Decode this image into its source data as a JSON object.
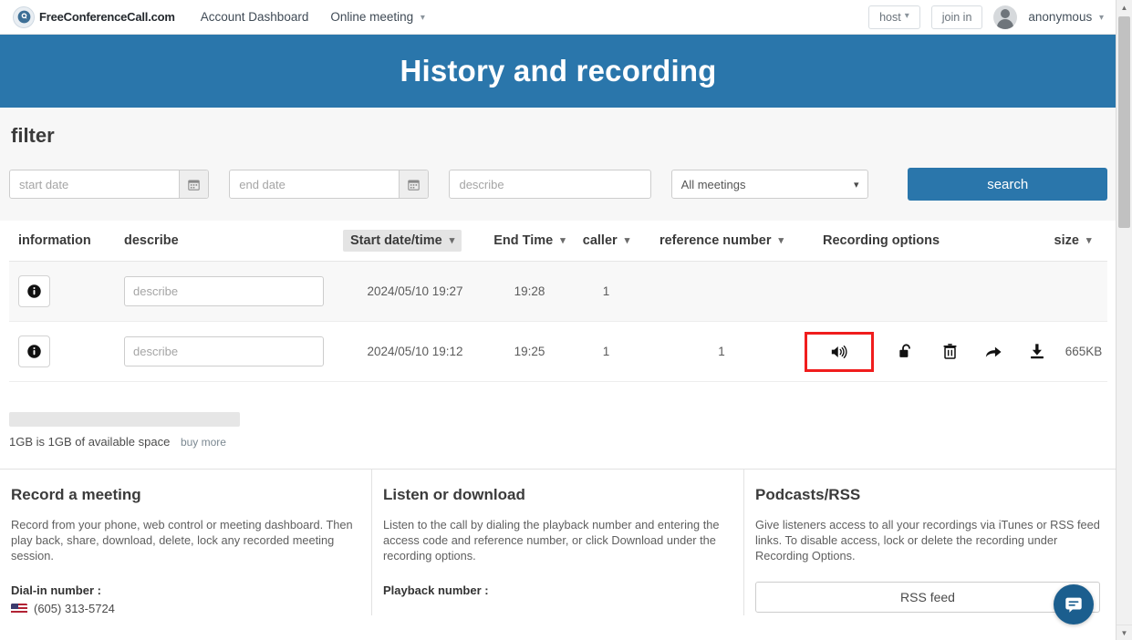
{
  "topnav": {
    "brand_name": "FreeConferenceCall.com",
    "brand_logo_icon": "phone-circle-icon",
    "links": [
      {
        "label": "Account Dashboard",
        "has_caret": false
      },
      {
        "label": "Online meeting",
        "has_caret": true
      }
    ],
    "host_button": "host",
    "join_button": "join in",
    "username": "anonymous",
    "avatar_icon": "user-avatar-icon"
  },
  "hero": {
    "title": "History and recording",
    "background_color": "#2a76ab"
  },
  "filter": {
    "title": "filter",
    "start_date_placeholder": "start date",
    "start_date_value": "",
    "end_date_placeholder": "end date",
    "end_date_value": "",
    "describe_placeholder": "describe",
    "describe_value": "",
    "meeting_select_value": "All meetings",
    "meeting_select_options": [
      "All meetings"
    ],
    "search_button": "search",
    "calendar_icon": "calendar-icon"
  },
  "table": {
    "headers": [
      {
        "label": "information",
        "sortable": false,
        "sorted": false
      },
      {
        "label": "describe",
        "sortable": false,
        "sorted": false
      },
      {
        "label": "Start date/time",
        "sortable": true,
        "sorted": true
      },
      {
        "label": "End Time",
        "sortable": true,
        "sorted": false
      },
      {
        "label": "caller",
        "sortable": true,
        "sorted": false
      },
      {
        "label": "reference number",
        "sortable": true,
        "sorted": false
      },
      {
        "label": "Recording options",
        "sortable": false,
        "sorted": false
      },
      {
        "label": "size",
        "sortable": true,
        "sorted": false
      }
    ],
    "rows": [
      {
        "info_icon": "info-circle-icon",
        "describe_placeholder": "describe",
        "describe_value": "",
        "start_datetime": "2024/05/10 19:27",
        "end_time": "19:28",
        "caller": "1",
        "reference_number": "",
        "size": "",
        "has_recording": false
      },
      {
        "info_icon": "info-circle-icon",
        "describe_placeholder": "describe",
        "describe_value": "",
        "start_datetime": "2024/05/10 19:12",
        "end_time": "19:25",
        "caller": "1",
        "reference_number": "1",
        "size": "665KB",
        "has_recording": true,
        "actions": [
          {
            "name": "play-audio-button",
            "icon": "speaker-volume-icon",
            "highlighted": true
          },
          {
            "name": "unlock-button",
            "icon": "unlock-padlock-icon",
            "highlighted": false
          },
          {
            "name": "delete-button",
            "icon": "trash-icon",
            "highlighted": false
          },
          {
            "name": "share-button",
            "icon": "share-arrow-icon",
            "highlighted": false
          },
          {
            "name": "download-button",
            "icon": "download-icon",
            "highlighted": false
          }
        ]
      }
    ]
  },
  "storage": {
    "text": "1GB is 1GB of available space",
    "buy_more_label": "buy more",
    "used_percent": 0
  },
  "bottom_sections": [
    {
      "title": "Record a meeting",
      "body": "Record from your phone, web control or meeting dashboard. Then play back, share, download, delete, lock any recorded meeting session.",
      "sub_label": "Dial-in number :",
      "phone": "(605) 313-5724",
      "flag_icon": "us-flag-icon"
    },
    {
      "title": "Listen or download",
      "body": "Listen to the call by dialing the playback number and entering the access code and reference number, or click Download under the recording options.",
      "sub_label": "Playback number :",
      "phone": "",
      "flag_icon": ""
    },
    {
      "title": "Podcasts/RSS",
      "body": "Give listeners access to all your recordings via iTunes or RSS feed links. To disable access, lock or delete the recording under Recording Options.",
      "sub_label": "",
      "rss_button": "RSS feed",
      "phone": "",
      "flag_icon": ""
    }
  ],
  "chat": {
    "icon": "chat-bubble-icon"
  },
  "scrollbar": {
    "up_arrow": "▲",
    "down_arrow": "▼"
  }
}
